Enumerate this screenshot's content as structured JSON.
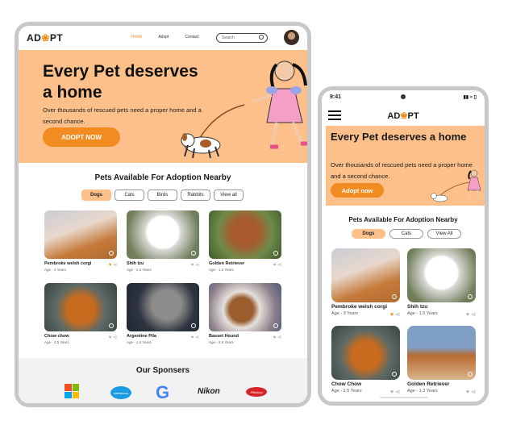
{
  "tablet": {
    "nav": {
      "logo": {
        "pre": "AD",
        "mid": "❀",
        "post": "PT"
      },
      "links": [
        "Home",
        "Adopt",
        "Contact"
      ],
      "active_link": "Home",
      "search_placeholder": "Search"
    },
    "hero": {
      "title": "Every Pet deserves a home",
      "text": "Over thousands of rescued pets need a proper home and a second chance.",
      "button": "ADOPT NOW"
    },
    "section_title": "Pets Available For Adoption Nearby",
    "filters": [
      "Dogs",
      "Cats",
      "Birds",
      "Rabbits",
      "View all"
    ],
    "active_filter": "Dogs",
    "pets": [
      {
        "name": "Pembroke welsh corgi",
        "age": "Age - 3 Years",
        "favorite": true
      },
      {
        "name": "Shih tzu",
        "age": "Age - 1.5 Years",
        "favorite": false
      },
      {
        "name": "Golden Retriever",
        "age": "Age - 1.2 Years",
        "favorite": false
      },
      {
        "name": "Chow chow",
        "age": "Age - 2.5 Years",
        "favorite": false
      },
      {
        "name": "Argentine Pila",
        "age": "Age - 1.6 Years",
        "favorite": false
      },
      {
        "name": "Basset Hound",
        "age": "Age - 3.6 Years",
        "favorite": false
      }
    ],
    "sponsors_title": "Our Sponsers",
    "sponsors": [
      "salesforce",
      "G",
      "Nikon",
      "Pillsbury"
    ]
  },
  "phone": {
    "status_time": "9:41",
    "logo": {
      "pre": "AD",
      "mid": "❀",
      "post": "PT"
    },
    "hero": {
      "title": "Every Pet deserves a home",
      "text": "Over thousands of rescued pets need a proper home  and a second chance.",
      "button": "Adopt now"
    },
    "section_title": "Pets Available For Adoption Nearby",
    "filters": [
      "Dogs",
      "Cats",
      "View All"
    ],
    "active_filter": "Dogs",
    "pets": [
      {
        "name": "Pembroke welsh corgi",
        "age": "Age - 3 Years",
        "favorite": true
      },
      {
        "name": "Shih tzu",
        "age": "Age - 1.5 Years",
        "favorite": false
      },
      {
        "name": "Chow Chow",
        "age": "Age - 2.5 Years",
        "favorite": false
      },
      {
        "name": "Golden Retriever",
        "age": "Age - 1.2 Years",
        "favorite": false
      }
    ]
  },
  "colors": {
    "accent": "#f28b20",
    "hero_bg": "#fdc08b"
  },
  "icons": [
    "search-icon",
    "heart-icon",
    "share-icon",
    "menu-icon",
    "wifi-icon",
    "battery-icon"
  ]
}
